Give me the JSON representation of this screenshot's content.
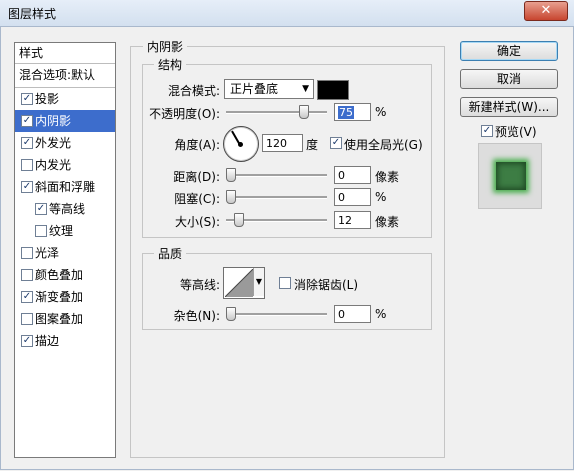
{
  "window": {
    "title": "图层样式",
    "close_label": "✕"
  },
  "style_list": {
    "header": "样式",
    "blend_options": "混合选项:默认",
    "items": [
      {
        "label": "投影",
        "checked": true
      },
      {
        "label": "内阴影",
        "checked": true
      },
      {
        "label": "外发光",
        "checked": true
      },
      {
        "label": "内发光",
        "checked": false
      },
      {
        "label": "斜面和浮雕",
        "checked": true
      },
      {
        "label": "等高线",
        "checked": true
      },
      {
        "label": "纹理",
        "checked": false
      },
      {
        "label": "光泽",
        "checked": false
      },
      {
        "label": "颜色叠加",
        "checked": false
      },
      {
        "label": "渐变叠加",
        "checked": true
      },
      {
        "label": "图案叠加",
        "checked": false
      },
      {
        "label": "描边",
        "checked": true
      }
    ]
  },
  "inner_shadow": {
    "title": "内阴影",
    "structure": {
      "title": "结构",
      "blend_mode_label": "混合模式:",
      "blend_mode_value": "正片叠底",
      "shadow_color": "#000000",
      "opacity_label": "不透明度(O):",
      "opacity_value": "75",
      "opacity_unit": "%",
      "angle_label": "角度(A):",
      "angle_value": "120",
      "angle_unit": "度",
      "global_light_label": "使用全局光(G)",
      "global_light_checked": true,
      "distance_label": "距离(D):",
      "distance_value": "0",
      "distance_unit": "像素",
      "choke_label": "阻塞(C):",
      "choke_value": "0",
      "choke_unit": "%",
      "size_label": "大小(S):",
      "size_value": "12",
      "size_unit": "像素"
    },
    "quality": {
      "title": "品质",
      "contour_label": "等高线:",
      "anti_alias_label": "消除锯齿(L)",
      "anti_alias_checked": false,
      "noise_label": "杂色(N):",
      "noise_value": "0",
      "noise_unit": "%"
    }
  },
  "buttons": {
    "ok": "确定",
    "cancel": "取消",
    "new_style": "新建样式(W)...",
    "preview_label": "预览(V)",
    "preview_checked": true
  }
}
